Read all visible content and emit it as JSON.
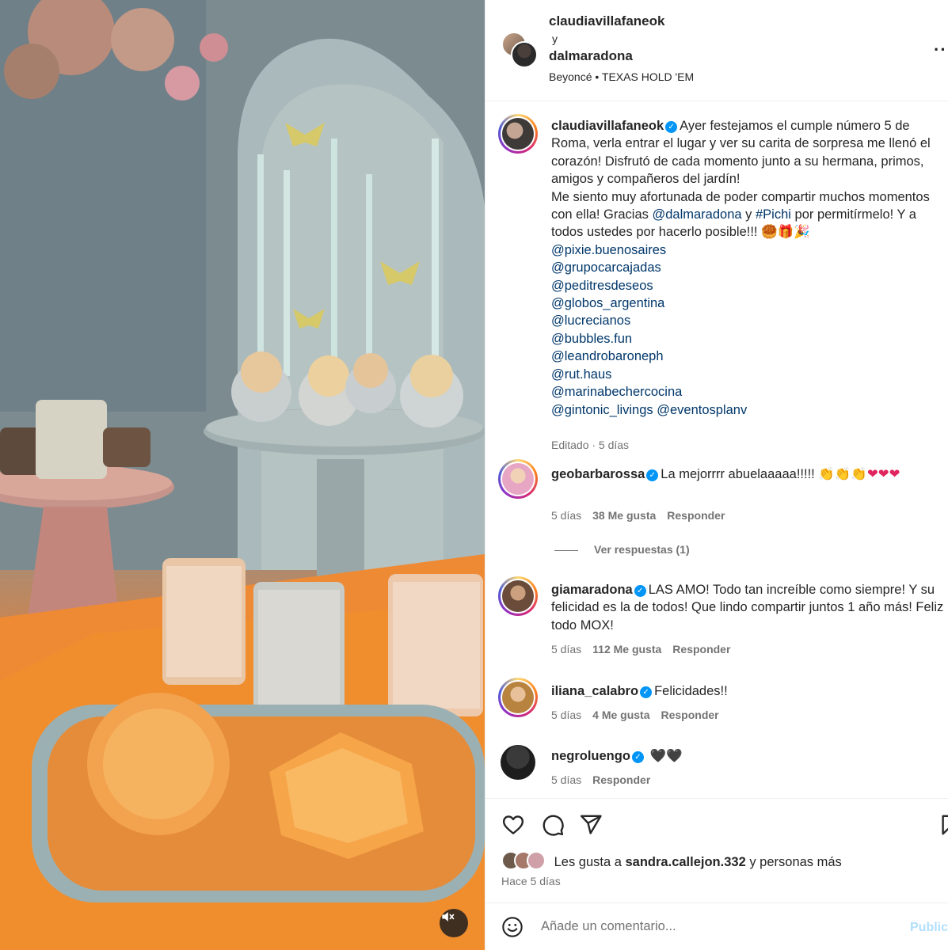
{
  "header": {
    "user1": "claudiavillafaneok",
    "connector": "y",
    "user2": "dalmaradona",
    "audio": "Beyoncé • TEXAS HOLD 'EM",
    "more_icon": "more-horizontal-icon"
  },
  "caption": {
    "username": "claudiavillafaneok",
    "text_1": "Ayer festejamos el cumple número 5 de Roma, verla entrar el lugar y ver su carita de sorpresa me llenó el corazón! Disfrutó de cada momento junto a su hermana, primos, amigos y compañeros del jardín!",
    "text_2a": "Me siento muy afortunada de poder compartir muchos momentos con ella! Gracias ",
    "mention_dalma": "@dalmaradona",
    "text_2b": " y ",
    "hashtag_pichi": "#Pichi",
    "text_2c": " por permitírmelo! Y a todos ustedes por hacerlo posible!!! ",
    "emojis": "🥮🎁🎉",
    "mentions": [
      "@pixie.buenosaires",
      "@grupocarcajadas",
      "@peditresdeseos",
      "@globos_argentina",
      "@lucrecianos",
      "@bubbles.fun",
      "@leandrobaroneph",
      "@rut.haus",
      "@marinabechercocina"
    ],
    "last_mention_1": "@gintonic_livings",
    "last_mention_2": "@eventosplanv",
    "edited": "Editado · 5 días"
  },
  "comments": [
    {
      "username": "geobarbarossa",
      "text": "La mejorrrr abuelaaaaa!!!!! ",
      "emojis": "👏👏👏❤❤❤",
      "age": "5 días",
      "likes": "38 Me gusta",
      "reply": "Responder",
      "view_replies": "Ver respuestas (1)"
    },
    {
      "username": "giamaradona",
      "text": "LAS AMO! Todo tan increíble como siempre! Y su felicidad es la de todos! Que lindo compartir juntos 1 año más! Feliz todo MOX!",
      "age": "5 días",
      "likes": "112 Me gusta",
      "reply": "Responder"
    },
    {
      "username": "iliana_calabro",
      "text": "Felicidades!!",
      "age": "5 días",
      "likes": "4 Me gusta",
      "reply": "Responder"
    },
    {
      "username": "negroluengo",
      "text": "🖤🖤",
      "age": "5 días",
      "reply": "Responder"
    }
  ],
  "actions": {
    "like_icon": "heart-icon",
    "comment_icon": "comment-icon",
    "share_icon": "send-icon",
    "save_icon": "bookmark-icon",
    "likes_prefix": "Les gusta a ",
    "likes_user": "sandra.callejon.332",
    "likes_suffix": " y personas más",
    "time": "Hace 5 días"
  },
  "comment_box": {
    "emoji_icon": "smiley-icon",
    "placeholder": "Añade un comentario...",
    "publish": "Publicar"
  },
  "media": {
    "mute_icon": "speaker-muted-icon"
  }
}
